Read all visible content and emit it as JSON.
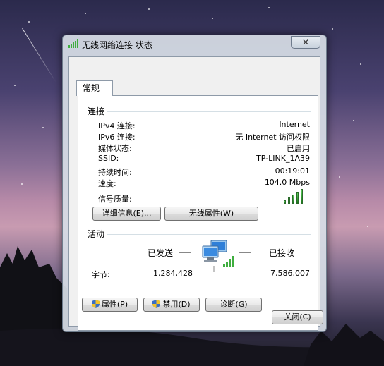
{
  "window": {
    "title": "无线网络连接 状态",
    "close_glyph": "✕"
  },
  "tabs": [
    {
      "label": "常规"
    }
  ],
  "connection": {
    "heading": "连接",
    "rows": [
      {
        "label": "IPv4 连接:",
        "value": "Internet"
      },
      {
        "label": "IPv6 连接:",
        "value": "无 Internet 访问权限"
      },
      {
        "label": "媒体状态:",
        "value": "已启用"
      },
      {
        "label": "SSID:",
        "value": "TP-LINK_1A39"
      },
      {
        "label": "持续时间:",
        "value": "00:19:01"
      },
      {
        "label": "速度:",
        "value": "104.0 Mbps"
      }
    ],
    "signal_label": "信号质量:",
    "signal_bars_lit": 5,
    "signal_bars_total": 5,
    "details_button": "详细信息(E)...",
    "wireless_props_button": "无线属性(W)"
  },
  "activity": {
    "heading": "活动",
    "sent_label": "已发送",
    "received_label": "已接收",
    "bytes_label": "字节:",
    "bytes_sent": "1,284,428",
    "bytes_received": "7,586,007"
  },
  "bottom_buttons": {
    "properties": "属性(P)",
    "disable": "禁用(D)",
    "diagnose": "诊断(G)"
  },
  "close_button": "关闭(C)",
  "colors": {
    "signal_green": "#3fae3f",
    "window_frame": "#d6dde5",
    "panel_bg": "#ffffff"
  },
  "icons": [
    "wifi-signal-icon",
    "network-computers-icon",
    "uac-shield-icon"
  ]
}
